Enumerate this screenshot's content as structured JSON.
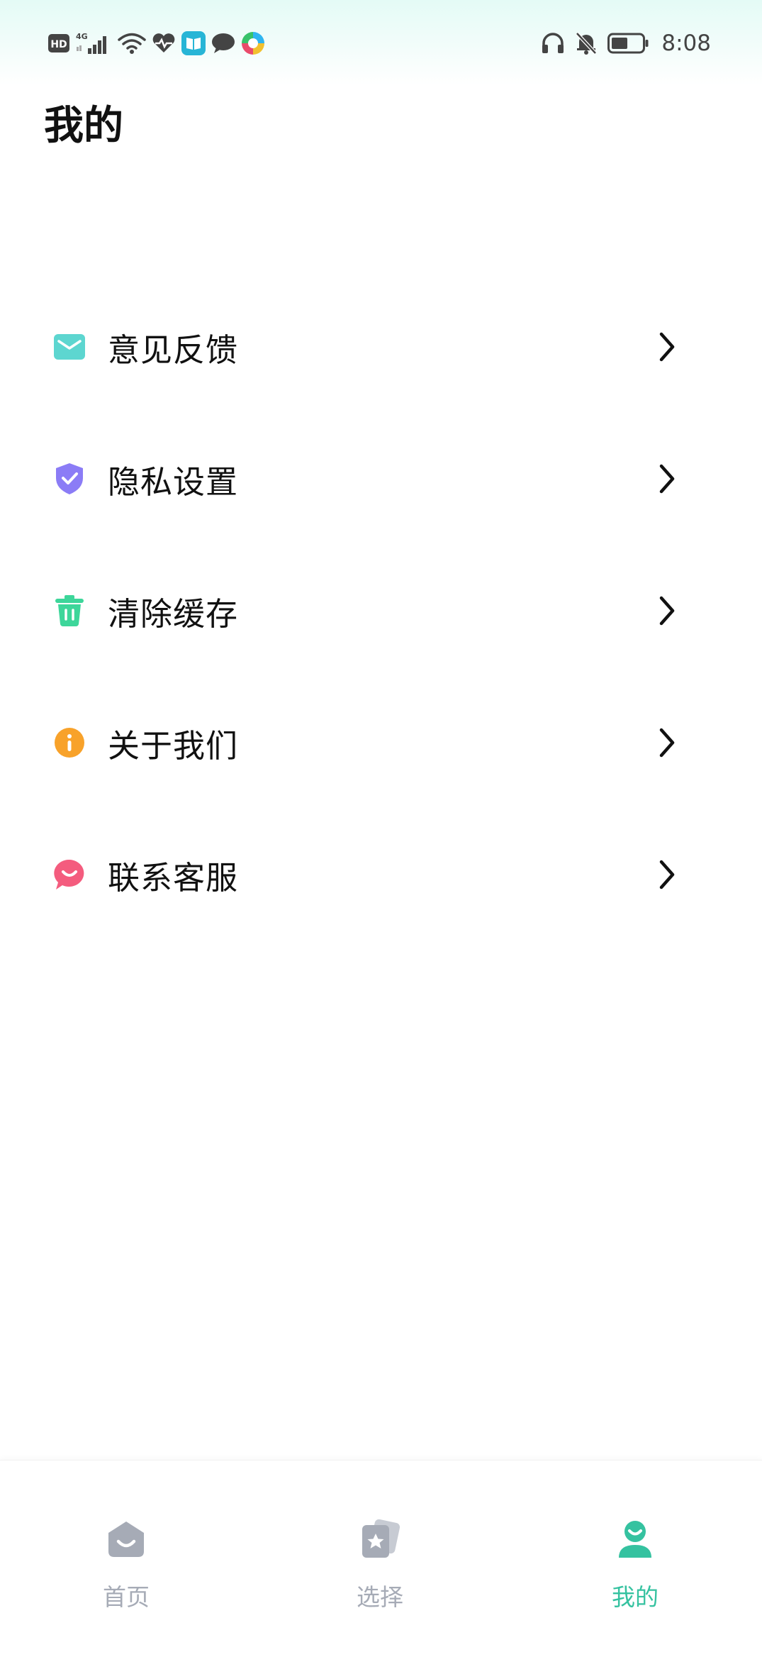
{
  "status_bar": {
    "time": "8:08",
    "hd_label": "HD",
    "network_label": "4G",
    "left_icons": [
      "hd-icon",
      "4g-signal-icon",
      "wifi-icon",
      "health-icon",
      "book-app-icon",
      "message-icon",
      "colorful-app-icon"
    ],
    "right_icons": [
      "headphones-icon",
      "bell-muted-icon",
      "battery-icon"
    ]
  },
  "header": {
    "title": "我的"
  },
  "menu": {
    "items": [
      {
        "label": "意见反馈",
        "icon": "mail-icon",
        "color": "#5dd6d0"
      },
      {
        "label": "隐私设置",
        "icon": "shield-check-icon",
        "color": "#8b7cf6"
      },
      {
        "label": "清除缓存",
        "icon": "trash-icon",
        "color": "#3dd69a"
      },
      {
        "label": "关于我们",
        "icon": "info-icon",
        "color": "#f8a22a"
      },
      {
        "label": "联系客服",
        "icon": "chat-smile-icon",
        "color": "#f45c7e"
      }
    ]
  },
  "tab_bar": {
    "tabs": [
      {
        "label": "首页",
        "icon": "home-icon",
        "active": false
      },
      {
        "label": "选择",
        "icon": "star-cards-icon",
        "active": false
      },
      {
        "label": "我的",
        "icon": "user-icon",
        "active": true
      }
    ],
    "active_color": "#35c2a0",
    "inactive_color": "#a6abb6"
  }
}
